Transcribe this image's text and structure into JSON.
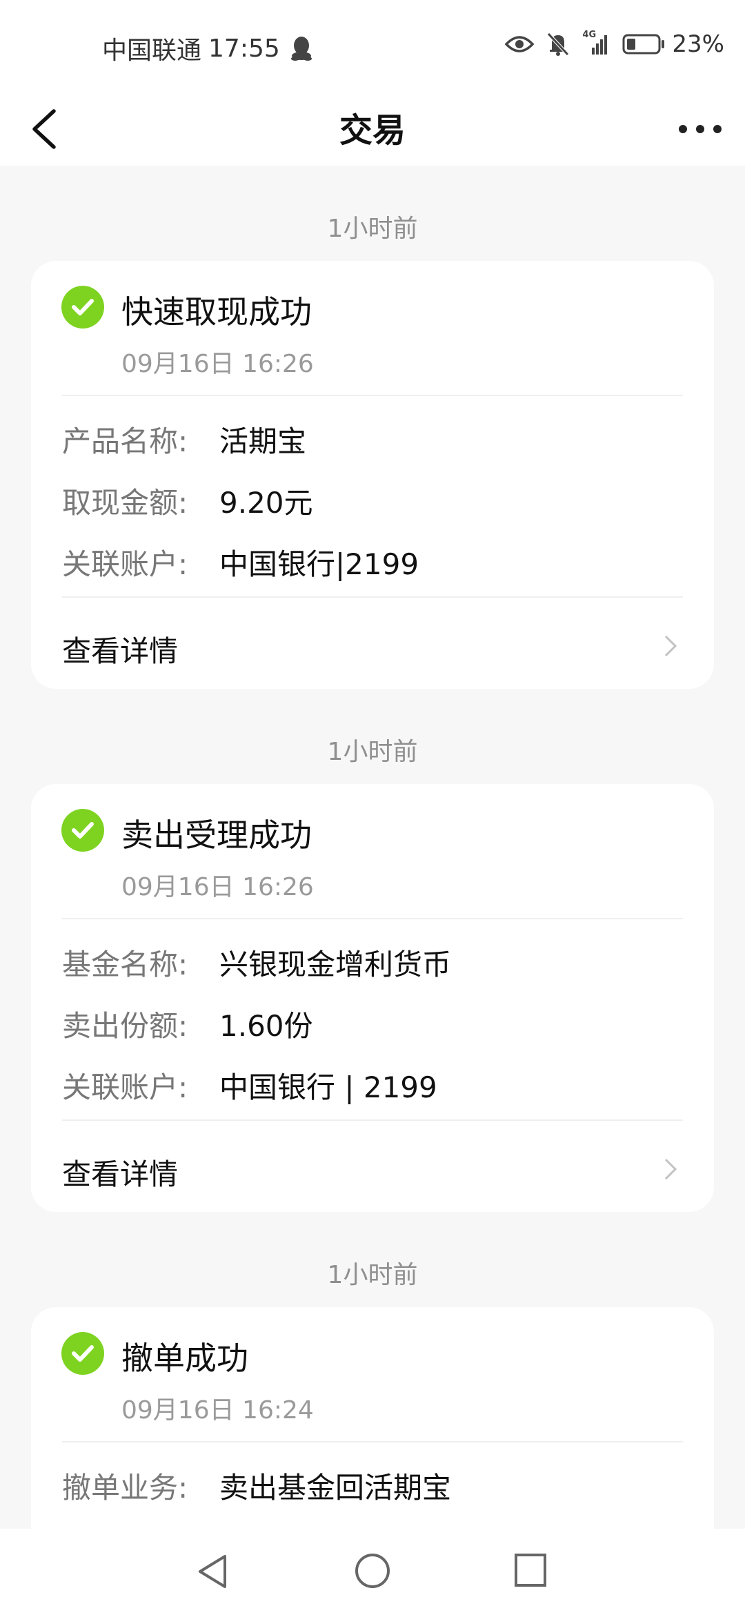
{
  "status_bar": {
    "carrier": "中国联通",
    "time": "17:55",
    "network": "4G",
    "battery": "23%"
  },
  "header": {
    "title": "交易"
  },
  "feed": [
    {
      "time_ago": "1小时前",
      "title": "快速取现成功",
      "datetime": "09月16日 16:26",
      "rows": [
        {
          "label": "产品名称:",
          "value": "活期宝"
        },
        {
          "label": "取现金额:",
          "value": "9.20元"
        },
        {
          "label": "关联账户:",
          "value": "中国银行|2199"
        }
      ],
      "details_label": "查看详情"
    },
    {
      "time_ago": "1小时前",
      "title": "卖出受理成功",
      "datetime": "09月16日 16:26",
      "rows": [
        {
          "label": "基金名称:",
          "value": "兴银现金增利货币"
        },
        {
          "label": "卖出份额:",
          "value": "1.60份"
        },
        {
          "label": "关联账户:",
          "value": "中国银行 | 2199"
        }
      ],
      "details_label": "查看详情"
    },
    {
      "time_ago": "1小时前",
      "title": "撤单成功",
      "datetime": "09月16日 16:24",
      "rows": [
        {
          "label": "撤单业务:",
          "value": "卖出基金回活期宝"
        }
      ]
    }
  ],
  "colors": {
    "success_green": "#7ed321",
    "background": "#f7f7f7",
    "card": "#ffffff"
  },
  "icons": [
    "qq-icon",
    "eye-icon",
    "bell-muted-icon",
    "signal-icon",
    "battery-icon",
    "back-arrow-icon",
    "more-dots-icon",
    "check-circle-icon",
    "chevron-right-icon",
    "nav-back-icon",
    "nav-home-icon",
    "nav-recents-icon"
  ]
}
